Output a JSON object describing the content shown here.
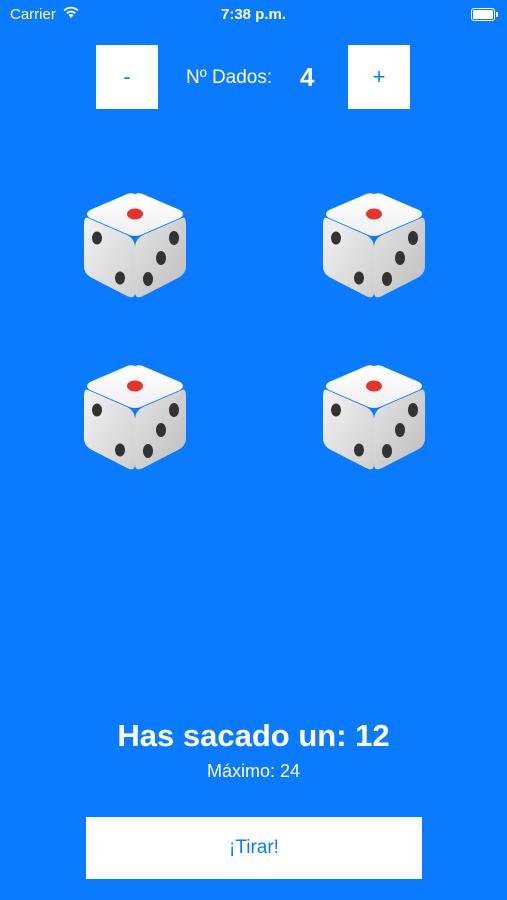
{
  "status_bar": {
    "carrier": "Carrier",
    "time": "7:38 p.m."
  },
  "counter": {
    "minus_label": "-",
    "label": "Nº Dados:",
    "value": "4",
    "plus_label": "+"
  },
  "dice": [
    {
      "pips_front": 2,
      "pips_right": 3,
      "pips_top": 1
    },
    {
      "pips_front": 2,
      "pips_right": 3,
      "pips_top": 1
    },
    {
      "pips_front": 2,
      "pips_right": 3,
      "pips_top": 1
    },
    {
      "pips_front": 2,
      "pips_right": 3,
      "pips_top": 1
    }
  ],
  "result": {
    "text": "Has sacado un: 12",
    "max_text": "Máximo: 24"
  },
  "roll_button": {
    "label": "¡Tirar!"
  },
  "colors": {
    "background": "#0a7bff",
    "button": "#ffffff",
    "accent": "#0a7bff",
    "pip_top": "#e8322c",
    "pip": "#333333"
  }
}
